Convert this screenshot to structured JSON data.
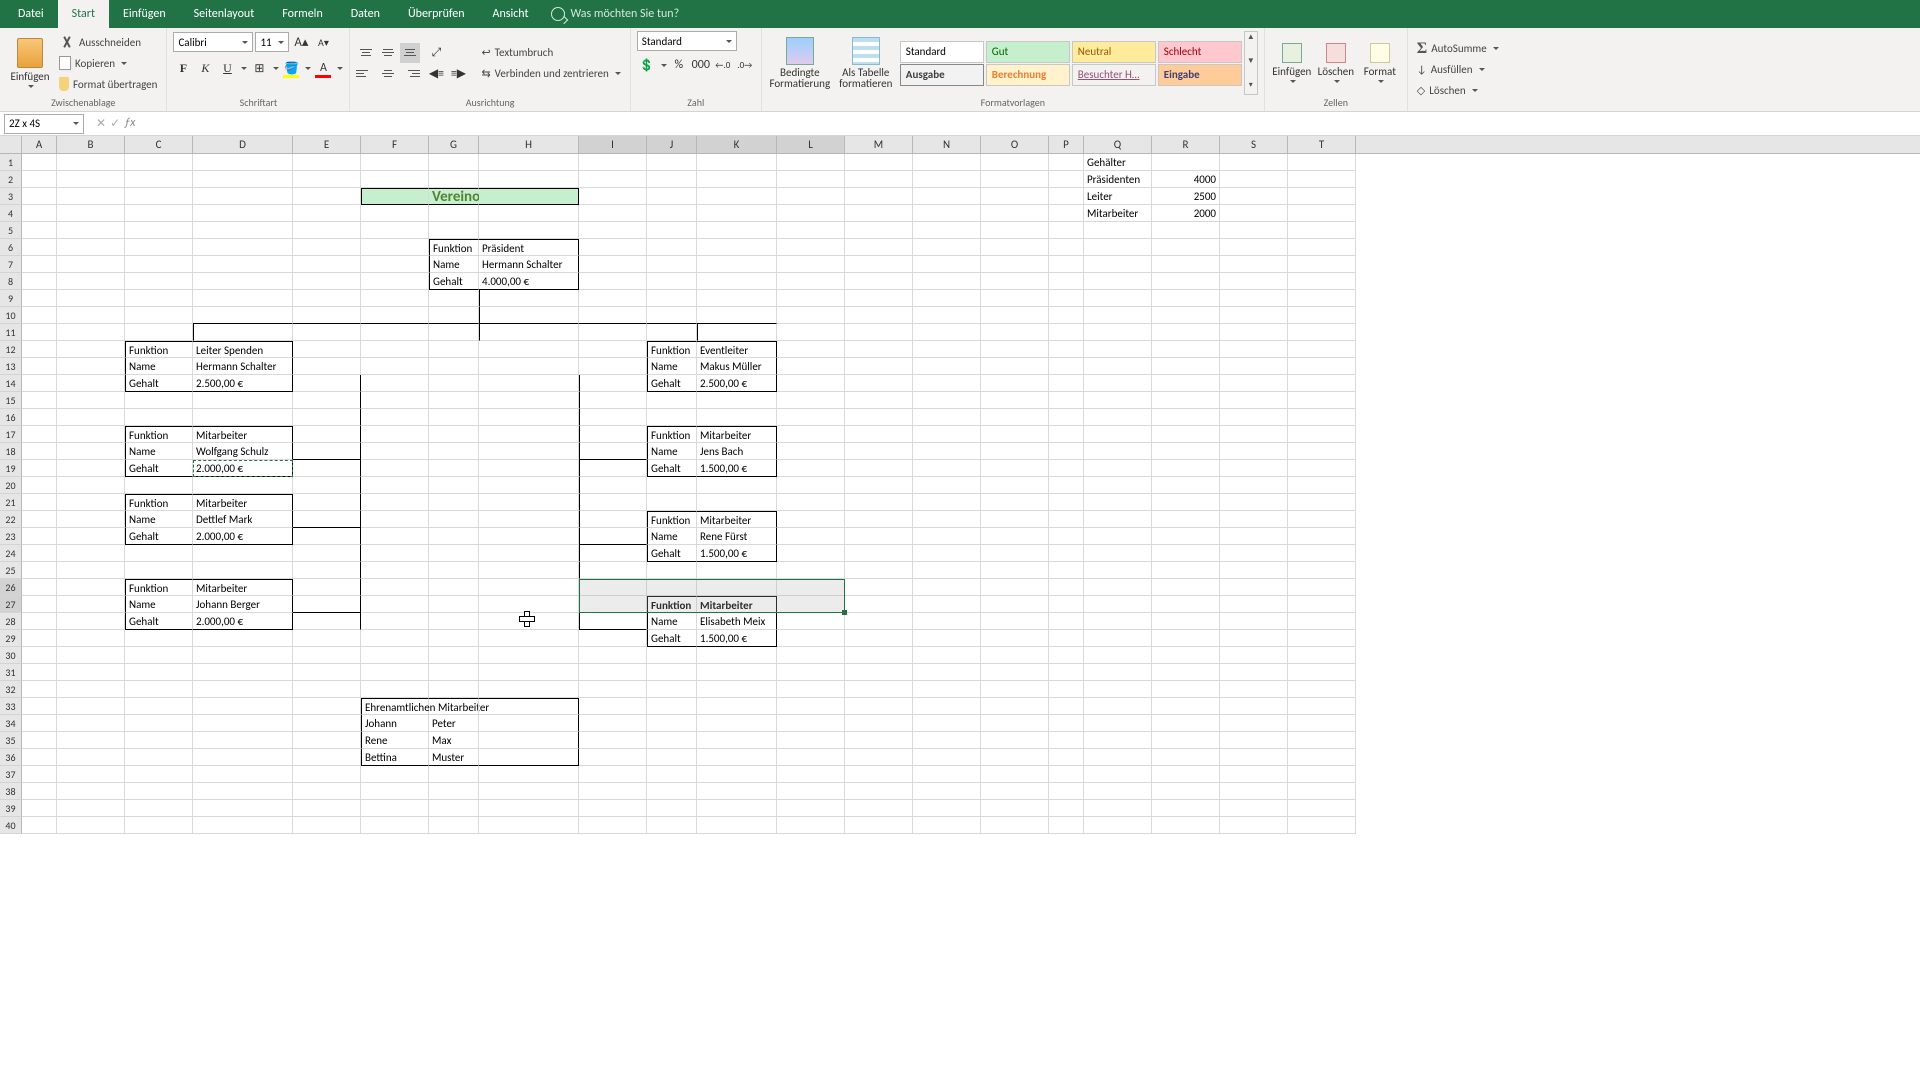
{
  "tabs": {
    "datei": "Datei",
    "start": "Start",
    "einfuegen": "Einfügen",
    "seitenlayout": "Seitenlayout",
    "formeln": "Formeln",
    "daten": "Daten",
    "ueberpruefen": "Überprüfen",
    "ansicht": "Ansicht",
    "tellme": "Was möchten Sie tun?"
  },
  "ribbon": {
    "clipboard": {
      "group": "Zwischenablage",
      "paste": "Einfügen",
      "cut": "Ausschneiden",
      "copy": "Kopieren",
      "brush": "Format übertragen"
    },
    "font": {
      "group": "Schriftart",
      "name": "Calibri",
      "size": "11",
      "bold": "F",
      "italic": "K",
      "underline": "U"
    },
    "align": {
      "group": "Ausrichtung",
      "wrap": "Textumbruch",
      "merge": "Verbinden und zentrieren"
    },
    "number": {
      "group": "Zahl",
      "format": "Standard"
    },
    "styles": {
      "group": "Formatvorlagen",
      "cond": "Bedingte\nFormatierung",
      "table": "Als Tabelle\nformatieren",
      "standard": "Standard",
      "gut": "Gut",
      "neutral": "Neutral",
      "schlecht": "Schlecht",
      "ausgabe": "Ausgabe",
      "berechnung": "Berechnung",
      "besucht": "Besuchter H…",
      "eingabe": "Eingabe"
    },
    "cells": {
      "group": "Zellen",
      "insert": "Einfügen",
      "delete": "Löschen",
      "format": "Format"
    },
    "edit": {
      "autosum": "AutoSumme",
      "fill": "Ausfüllen",
      "clear": "Löschen"
    }
  },
  "namebox": "2Z x 4S",
  "cols": {
    "A": 35,
    "B": 68,
    "C": 68,
    "D": 100,
    "E": 68,
    "F": 68,
    "G": 50,
    "H": 100,
    "I": 68,
    "J": 50,
    "K": 80,
    "L": 68,
    "M": 68,
    "N": 68,
    "O": 68,
    "P": 35,
    "Q": 68,
    "R": 68,
    "S": 68,
    "T": 68
  },
  "sheet": {
    "title": "Vereinorganigramm",
    "salaryHdr": "Gehälter",
    "salaryRows": [
      [
        "Präsidenten",
        "4000"
      ],
      [
        "Leiter",
        "2500"
      ],
      [
        "Mitarbeiter",
        "2000"
      ]
    ],
    "labels": {
      "funktion": "Funktion",
      "name": "Name",
      "gehalt": "Gehalt"
    },
    "president": {
      "funktion": "Präsident",
      "name": "Hermann Schalter",
      "gehalt": "4.000,00 €"
    },
    "leiterSpenden": {
      "funktion": "Leiter Spenden",
      "name": "Hermann Schalter",
      "gehalt": "2.500,00 €"
    },
    "eventleiter": {
      "funktion": "Eventleiter",
      "name": "Makus Müller",
      "gehalt": "2.500,00 €"
    },
    "ma1": {
      "funktion": "Mitarbeiter",
      "name": "Wolfgang Schulz",
      "gehalt": "2.000,00 €"
    },
    "ma2": {
      "funktion": "Mitarbeiter",
      "name": "Dettlef Mark",
      "gehalt": "2.000,00 €"
    },
    "ma3": {
      "funktion": "Mitarbeiter",
      "name": "Johann Berger",
      "gehalt": "2.000,00 €"
    },
    "mb1": {
      "funktion": "Mitarbeiter",
      "name": "Jens Bach",
      "gehalt": "1.500,00 €"
    },
    "mb2": {
      "funktion": "Mitarbeiter",
      "name": "Rene Fürst",
      "gehalt": "1.500,00 €"
    },
    "mb3": {
      "funktion": "Mitarbeiter",
      "name": "Elisabeth Meix",
      "gehalt": "1.500,00 €"
    },
    "volunteerHdr": "Ehrenamtlichen Mitarbeiter",
    "volunteers": [
      [
        "Johann",
        "Peter"
      ],
      [
        "Rene",
        "Max"
      ],
      [
        "Bettina",
        "Muster"
      ]
    ]
  }
}
